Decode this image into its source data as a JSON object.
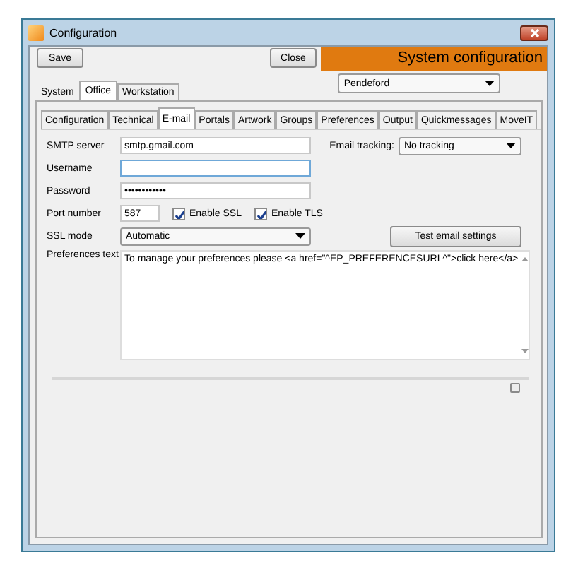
{
  "window": {
    "title": "Configuration"
  },
  "toolbar": {
    "save": "Save",
    "close": "Close",
    "banner": "System configuration",
    "site": "Pendeford"
  },
  "tabs": [
    {
      "label": "System",
      "selected": false
    },
    {
      "label": "Office",
      "selected": true
    },
    {
      "label": "Workstation",
      "selected": false
    }
  ],
  "sub_tabs": [
    {
      "label": "Configuration",
      "selected": false
    },
    {
      "label": "Technical",
      "selected": false
    },
    {
      "label": "E-mail",
      "selected": true
    },
    {
      "label": "Portals",
      "selected": false
    },
    {
      "label": "Artwork",
      "selected": false
    },
    {
      "label": "Groups",
      "selected": false
    },
    {
      "label": "Preferences",
      "selected": false
    },
    {
      "label": "Output",
      "selected": false
    },
    {
      "label": "Quickmessages",
      "selected": false
    },
    {
      "label": "MoveIT",
      "selected": false
    }
  ],
  "fields": [
    {
      "label": "SMTP server",
      "kind": "text",
      "value": "smtp.gmail.com",
      "focused": false
    },
    {
      "label": "Username",
      "kind": "text",
      "focused": true
    },
    {
      "label": "Password",
      "kind": "text",
      "value": "••••••••••••",
      "focused": false
    },
    {
      "label": "Port number",
      "kind": "port",
      "value": "587",
      "focused": false,
      "checkboxes": [
        {
          "label": "Enable SSL",
          "checked": true
        },
        {
          "label": "Enable TLS",
          "checked": true
        }
      ]
    },
    {
      "label": "SSL mode",
      "kind": "select",
      "value": "Automatic"
    }
  ],
  "email_tracking": {
    "label": "Email tracking:",
    "value": "No tracking"
  },
  "test_button": "Test email settings",
  "preferences": {
    "label": "Preferences text",
    "value": "To manage your preferences please <a href=\"^EP_PREFERENCESURL^\">click here</a>"
  },
  "bottom_checkbox": {
    "checked": false
  }
}
